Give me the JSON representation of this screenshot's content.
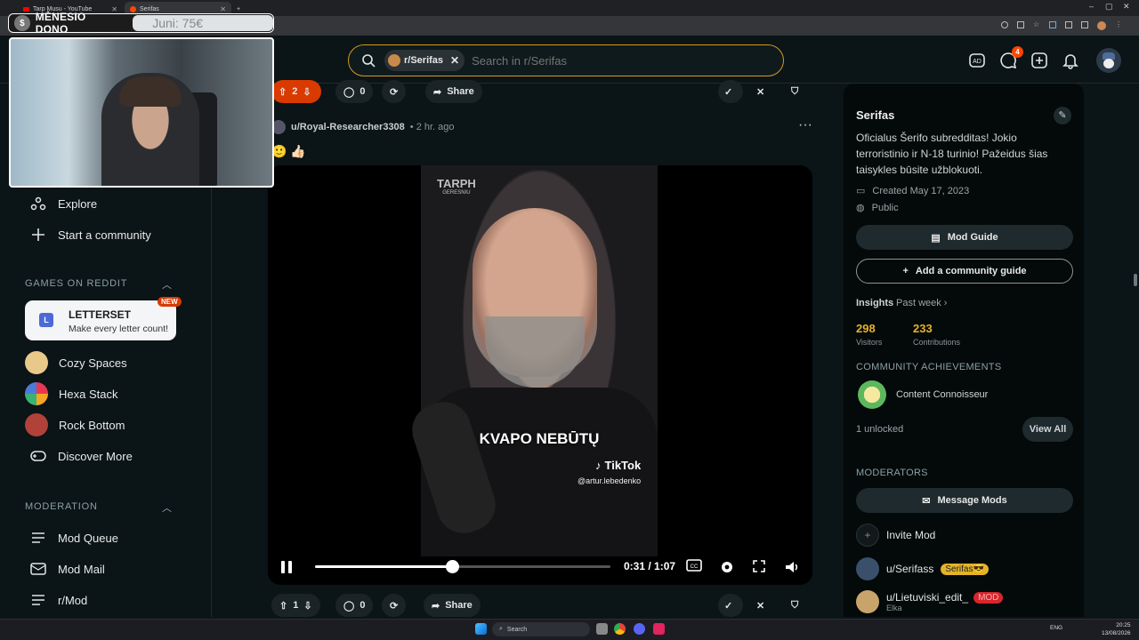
{
  "browser": {
    "tabs": [
      {
        "label": "Tarp Musu - YouTube",
        "icon_color": "#ff0000"
      },
      {
        "label": "Serifas",
        "icon_color": "#ff4500"
      }
    ],
    "window_controls": [
      "–",
      "▢",
      "✕"
    ]
  },
  "overlay": {
    "donation_label": "MĖNESIO DONO",
    "donation_goal": "Juni: 75€",
    "coin_symbol": "$"
  },
  "header": {
    "community_chip": "r/Serifas",
    "search_placeholder": "Search in r/Serifas",
    "chat_badge": "4"
  },
  "sidebar": {
    "top_items": [
      {
        "label": "Explore",
        "icon": "explore-icon"
      },
      {
        "label": "Start a community",
        "icon": "plus-icon"
      }
    ],
    "games_heading": "GAMES ON REDDIT",
    "featured_game": {
      "title": "LETTERSET",
      "subtitle": "Make every letter count!",
      "badge": "NEW",
      "letter": "L"
    },
    "games": [
      {
        "label": "Cozy Spaces",
        "color": "#e9c98a"
      },
      {
        "label": "Hexa Stack",
        "color": "#e6394f"
      },
      {
        "label": "Rock Bottom",
        "color": "#b0423a"
      },
      {
        "label": "Discover More",
        "color": ""
      }
    ],
    "moderation_heading": "MODERATION",
    "moderation_items": [
      {
        "label": "Mod Queue"
      },
      {
        "label": "Mod Mail"
      },
      {
        "label": "r/Mod"
      }
    ]
  },
  "post_top_bar": {
    "votes": "2",
    "comments": "0",
    "share": "Share"
  },
  "post": {
    "author": "u/Royal-Researcher3308",
    "time": "• 2 hr. ago",
    "emoji": "🙂 👍🏻",
    "video": {
      "watermark": "TARPH",
      "watermark_sub": "GERESNIU",
      "caption": "KVAPO NEBŪTŲ",
      "tiktok": "TikTok",
      "handle": "@artur.lebedenko",
      "time": "0:31 / 1:07",
      "progress": 0.463
    }
  },
  "post_bottom_bar": {
    "votes": "1",
    "comments": "0",
    "share": "Share"
  },
  "right_panel": {
    "name": "Serifas",
    "description": "Oficialus Šerifo subredditas! Jokio terroristinio ir N-18 turinio! Pažeidus šias taisykles būsite užblokuoti.",
    "created": "Created May 17, 2023",
    "visibility": "Public",
    "mod_guide": "Mod Guide",
    "add_guide": "Add a community guide",
    "insights": "Insights",
    "insights_period": "Past week",
    "visitors_value": "298",
    "visitors_label": "Visitors",
    "contrib_value": "233",
    "contrib_label": "Contributions",
    "achievements_heading": "COMMUNITY ACHIEVEMENTS",
    "achievement": "Content Connoisseur",
    "unlocked": "1 unlocked",
    "view_all": "View All",
    "moderators_heading": "MODERATORS",
    "message_mods": "Message Mods",
    "invite_mod": "Invite Mod",
    "mods": [
      {
        "name": "u/Serifass",
        "flair": "Serifas😎",
        "sub": ""
      },
      {
        "name": "u/Lietuviski_edit_",
        "flair": "MOD",
        "sub": "Elka"
      }
    ]
  },
  "taskbar": {
    "search": "Search",
    "lang": "ENG",
    "time": "20:25",
    "date": "13/08/2026"
  }
}
